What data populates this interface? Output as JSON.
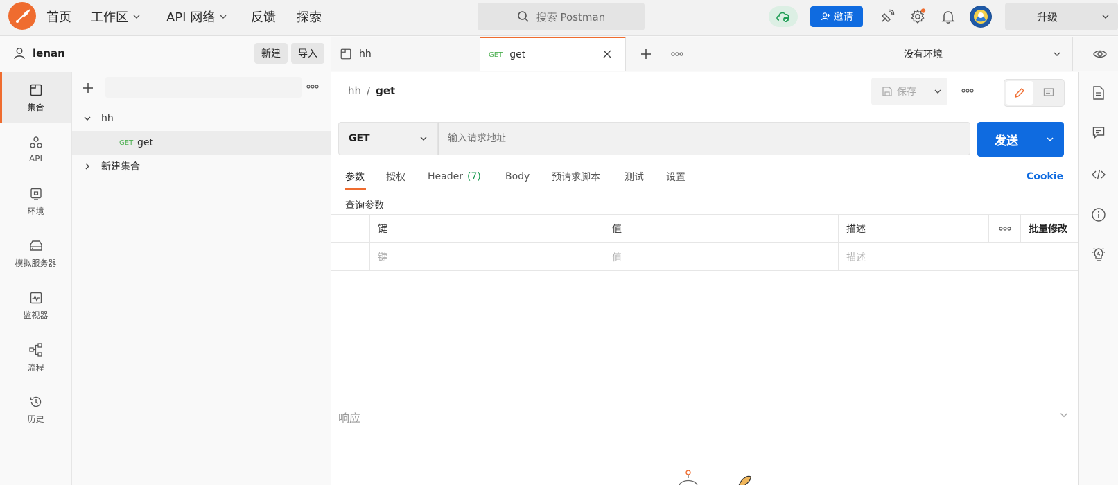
{
  "topbar": {
    "nav": [
      {
        "label": "首页",
        "has_chevron": false
      },
      {
        "label": "工作区",
        "has_chevron": true
      },
      {
        "label": "API 网络",
        "has_chevron": true
      },
      {
        "label": "反馈",
        "has_chevron": false
      },
      {
        "label": "探索",
        "has_chevron": false
      }
    ],
    "search_placeholder": "搜索 Postman",
    "invite_label": "邀请",
    "upgrade_label": "升级",
    "icons": [
      "cloud-sync-icon",
      "satellite-icon",
      "settings-icon",
      "bell-icon",
      "avatar"
    ]
  },
  "workspace": {
    "user": "lenan",
    "new_label": "新建",
    "import_label": "导入"
  },
  "rail": {
    "items": [
      {
        "label": "集合",
        "icon": "collection-icon",
        "active": true
      },
      {
        "label": "API",
        "icon": "api-icon",
        "active": false
      },
      {
        "label": "环境",
        "icon": "environment-icon",
        "active": false
      },
      {
        "label": "模拟服务器",
        "icon": "mock-server-icon",
        "active": false
      },
      {
        "label": "监视器",
        "icon": "monitor-icon",
        "active": false
      },
      {
        "label": "流程",
        "icon": "flow-icon",
        "active": false
      },
      {
        "label": "历史",
        "icon": "history-icon",
        "active": false
      }
    ]
  },
  "collections": {
    "tree": [
      {
        "label": "hh",
        "expanded": true
      },
      {
        "method": "GET",
        "label": "get",
        "selected": true
      },
      {
        "label": "新建集合",
        "expanded": false
      }
    ]
  },
  "tabs": {
    "items": [
      {
        "label": "hh",
        "method": ""
      },
      {
        "label": "get",
        "method": "GET"
      }
    ],
    "environment": "没有环境"
  },
  "request": {
    "breadcrumb_parent": "hh",
    "breadcrumb_sep": "/",
    "breadcrumb_current": "get",
    "save_label": "保存",
    "method": "GET",
    "url_placeholder": "输入请求地址",
    "send_label": "发送",
    "tabs": [
      {
        "label": "参数",
        "active": true
      },
      {
        "label": "授权",
        "active": false
      },
      {
        "label": "Header",
        "count": "(7)",
        "active": false
      },
      {
        "label": "Body",
        "active": false
      },
      {
        "label": "预请求脚本",
        "active": false
      },
      {
        "label": "测试",
        "active": false
      },
      {
        "label": "设置",
        "active": false
      }
    ],
    "cookie_label": "Cookie",
    "query_params_title": "查询参数",
    "table": {
      "headers": [
        "键",
        "值",
        "描述",
        "批量修改"
      ],
      "placeholders": [
        "键",
        "值",
        "描述"
      ]
    }
  },
  "response": {
    "title": "响应"
  },
  "colors": {
    "accent": "#ef6c2f",
    "primary": "#0f6be0",
    "get_method": "#4caf50"
  }
}
